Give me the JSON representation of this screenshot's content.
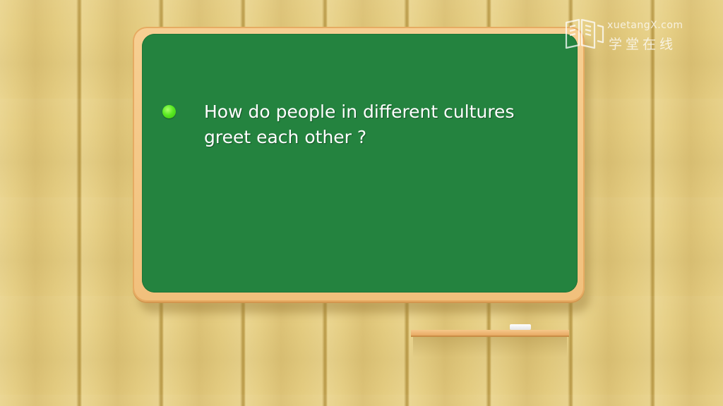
{
  "slide": {
    "question_line1": "How do people in different cultures",
    "question_line2": "greet each other ?"
  },
  "watermark": {
    "brand": "xuetangX.com",
    "brand_cn": "学堂在线",
    "icon": "book-logo-icon"
  },
  "colors": {
    "board_green": "#24833f",
    "frame": "#f1c07c",
    "bullet": "#5bea23",
    "wood": "#e6cf85"
  }
}
